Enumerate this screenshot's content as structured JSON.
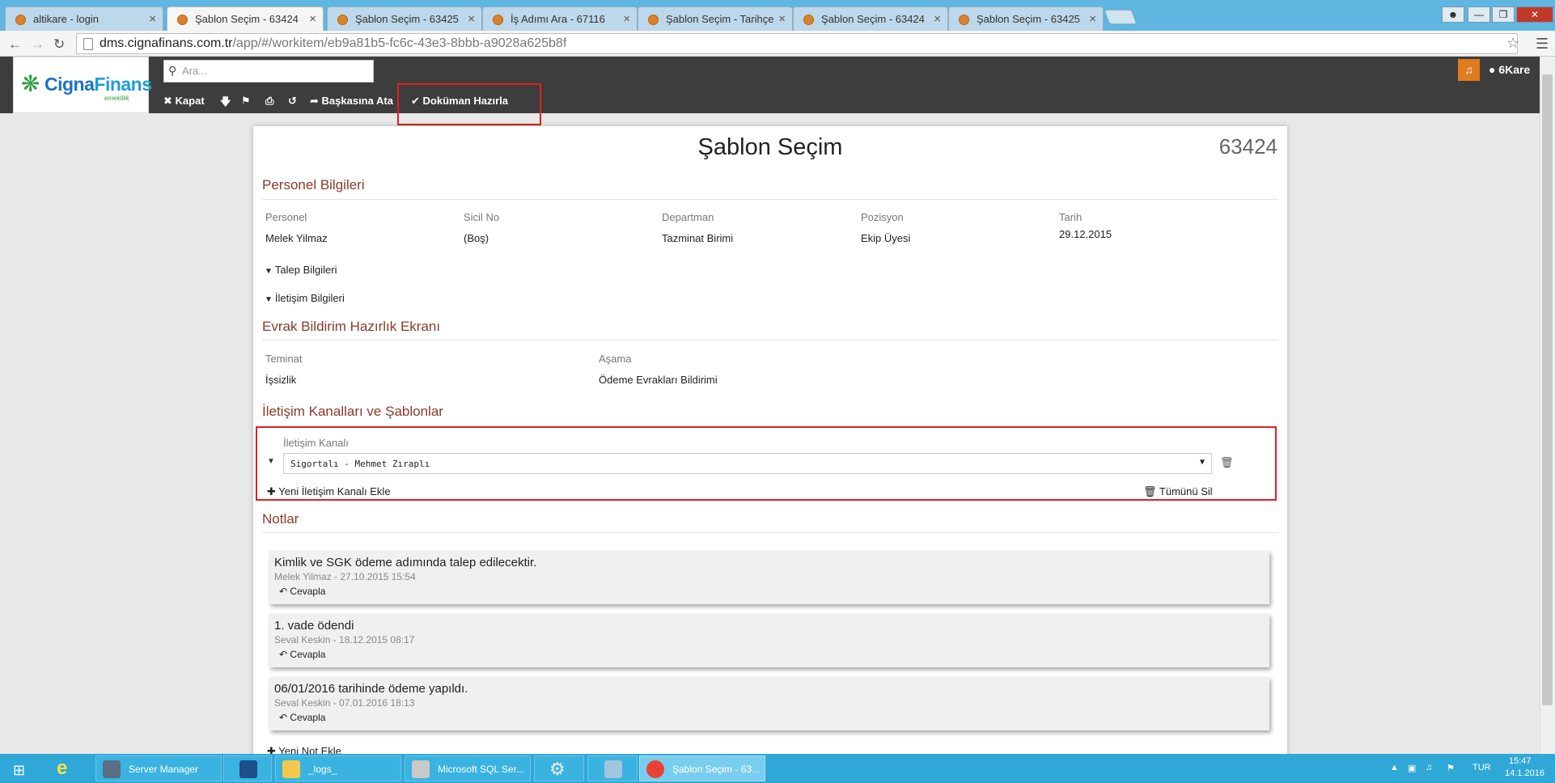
{
  "browser": {
    "tabs": [
      {
        "title": "altikare - login",
        "active": false
      },
      {
        "title": "Şablon Seçim - 63424",
        "active": true
      },
      {
        "title": "Şablon Seçim - 63425",
        "active": false
      },
      {
        "title": "İş Adımı Ara - 67116",
        "active": false
      },
      {
        "title": "Şablon Seçim - Tarihçe",
        "active": false
      },
      {
        "title": "Şablon Seçim - 63424",
        "active": false
      },
      {
        "title": "Şablon Seçim - 63425",
        "active": false
      }
    ],
    "url_host": "dms.cignafinans.com.tr",
    "url_path": "/app/#/workitem/eb9a81b5-fc6c-43e3-8bbb-a9028a625b8f"
  },
  "header": {
    "logo_part1": "Cigna",
    "logo_part2": "Finans",
    "logo_sub": "emeklilik",
    "search_placeholder": "Ara...",
    "toolbar": {
      "kapat": "Kapat",
      "baskasina_ata": "Başkasına Ata",
      "dokuman_hazirla": "Doküman Hazırla"
    },
    "user": "6Kare"
  },
  "page": {
    "title": "Şablon Seçim",
    "workitem_id": "63424",
    "personel_section": "Personel Bilgileri",
    "personel_fields": [
      {
        "label": "Personel",
        "value": "Melek Yilmaz"
      },
      {
        "label": "Sicil No",
        "value": "(Boş)"
      },
      {
        "label": "Departman",
        "value": "Tazminat Birimi"
      },
      {
        "label": "Pozisyon",
        "value": "Ekip Üyesi"
      },
      {
        "label": "Tarih",
        "value": "29.12.2015"
      }
    ],
    "talep_toggle": "Talep Bilgileri",
    "iletisim_toggle": "İletişim Bilgileri",
    "evrak_section": "Evrak Bildirim Hazırlık Ekranı",
    "evrak_fields": [
      {
        "label": "Teminat",
        "value": "İşsizlik"
      },
      {
        "label": "Aşama",
        "value": "Ödeme Evrakları Bildirimi"
      }
    ],
    "kanal_section": "İletişim Kanalları ve Şablonlar",
    "kanal_label": "İletişim Kanalı",
    "kanal_value": "Sigortalı - Mehmet Zıraplı",
    "yeni_kanal": "Yeni İletişim Kanalı Ekle",
    "tumunu_sil": "Tümünü Sil",
    "notes_section": "Notlar",
    "notes": [
      {
        "text": "Kimlik ve SGK ödeme adımında talep edilecektir.",
        "meta": "Melek Yilmaz - 27.10.2015 15:54",
        "reply": "Cevapla"
      },
      {
        "text": "1. vade ödendi",
        "meta": "Seval Keskin - 18.12.2015 08:17",
        "reply": "Cevapla"
      },
      {
        "text": "06/01/2016 tarihinde ödeme yapıldı.",
        "meta": "Seval Keskin - 07.01.2016 18:13",
        "reply": "Cevapla"
      }
    ],
    "yeni_not": "Yeni Not Ekle"
  },
  "taskbar": {
    "items": [
      {
        "label": "Server Manager"
      },
      {
        "label": ""
      },
      {
        "label": "_logs_"
      },
      {
        "label": "Microsoft SQL Ser..."
      },
      {
        "label": ""
      },
      {
        "label": ""
      },
      {
        "label": "Şablon Seçim - 63..."
      }
    ],
    "language": "TUR",
    "time": "15:47",
    "date": "14.1.2016"
  },
  "colors": {
    "section_title": "#8b3b2a",
    "header_bg": "#3d3d3d",
    "highlight_border": "#e02020",
    "taskbar": "#2fa8d8",
    "bell": "#e07b1e"
  }
}
